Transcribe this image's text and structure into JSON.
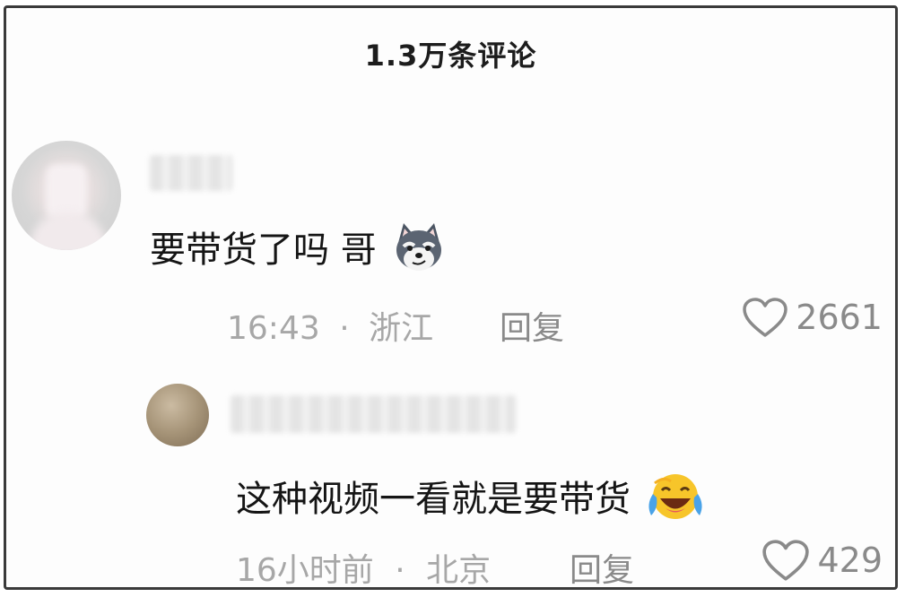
{
  "header": {
    "title": "1.3万条评论"
  },
  "comments": [
    {
      "text": "要带货了吗 哥",
      "emoji_icon": "smirking-dog-emoji",
      "time": "16:43",
      "location_sep": "·",
      "location": "浙江",
      "reply_label": "回复",
      "likes": "2661"
    },
    {
      "text": "这种视频一看就是要带货",
      "emoji_icon": "laughing-tears-emoji",
      "time": "16小时前",
      "location_sep": "·",
      "location": "北京",
      "reply_label": "回复",
      "likes": "429"
    }
  ],
  "colors": {
    "text_primary": "#151515",
    "text_meta": "#a7a7a7",
    "text_reply": "#8a8a8a"
  }
}
